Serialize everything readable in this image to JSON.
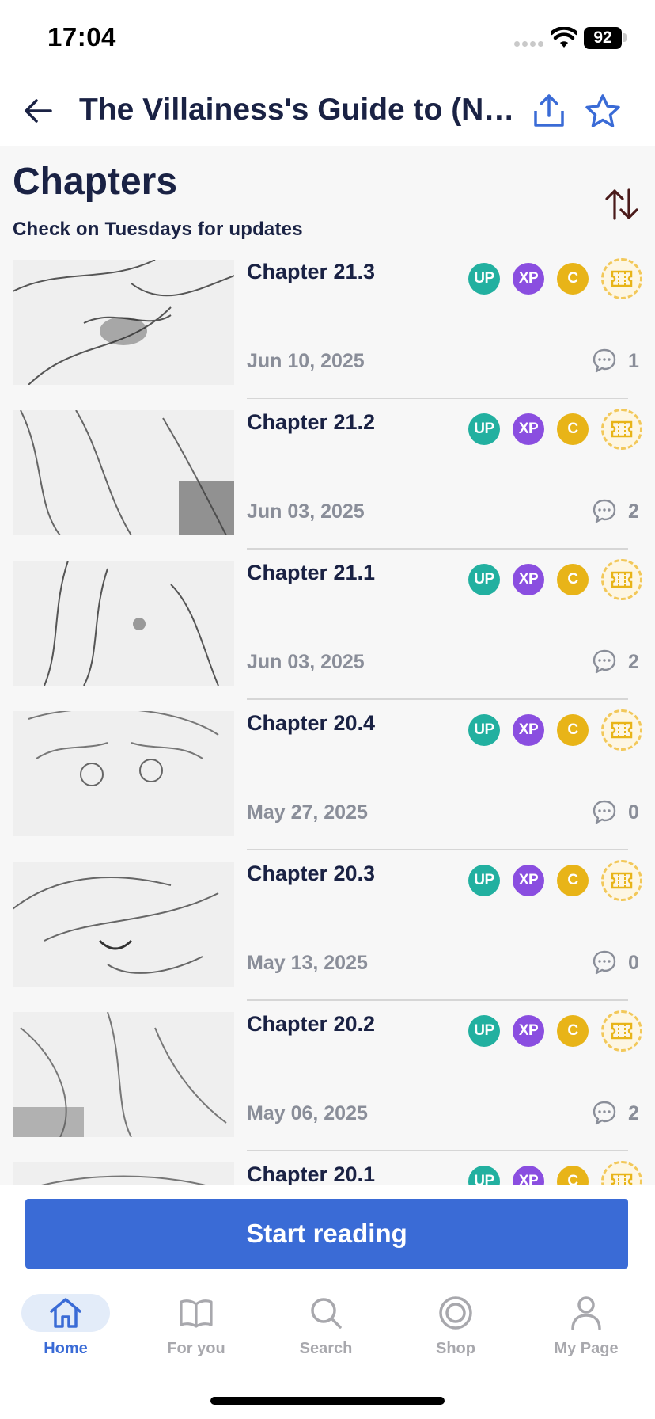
{
  "status_bar": {
    "time": "17:04",
    "battery": "92"
  },
  "header": {
    "title": "The Villainess's Guide to (No...",
    "back_icon": "arrow-left-icon",
    "share_icon": "share-icon",
    "favorite_icon": "star-outline-icon"
  },
  "section": {
    "title": "Chapters",
    "update_note": "Check on Tuesdays for updates",
    "sort_icon": "sort-arrows-icon"
  },
  "badges": {
    "up": "UP",
    "xp": "XP",
    "c": "C"
  },
  "chapters": [
    {
      "title": "Chapter 21.3",
      "date": "Jun 10, 2025",
      "comments": "1"
    },
    {
      "title": "Chapter 21.2",
      "date": "Jun 03, 2025",
      "comments": "2"
    },
    {
      "title": "Chapter 21.1",
      "date": "Jun 03, 2025",
      "comments": "2"
    },
    {
      "title": "Chapter 20.4",
      "date": "May 27, 2025",
      "comments": "0"
    },
    {
      "title": "Chapter 20.3",
      "date": "May 13, 2025",
      "comments": "0"
    },
    {
      "title": "Chapter 20.2",
      "date": "May 06, 2025",
      "comments": "2"
    },
    {
      "title": "Chapter 20.1",
      "date": "",
      "comments": ""
    }
  ],
  "cta": {
    "start_reading": "Start reading"
  },
  "nav": {
    "items": [
      {
        "label": "Home",
        "icon": "home-icon",
        "active": true
      },
      {
        "label": "For you",
        "icon": "book-icon",
        "active": false
      },
      {
        "label": "Search",
        "icon": "search-icon",
        "active": false
      },
      {
        "label": "Shop",
        "icon": "shop-coin-icon",
        "active": false
      },
      {
        "label": "My Page",
        "icon": "person-icon",
        "active": false
      }
    ]
  },
  "colors": {
    "accent": "#3a6bd6",
    "title_text": "#1a2244",
    "badge_up": "#22b0a0",
    "badge_xp": "#8a4ee0",
    "badge_c": "#e8b418"
  }
}
